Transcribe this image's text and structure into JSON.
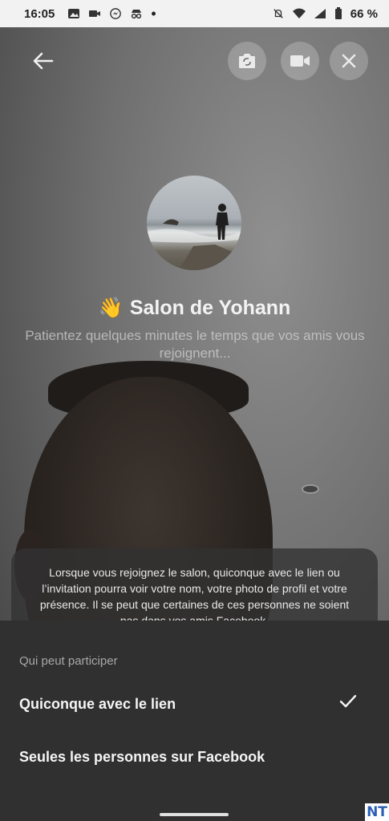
{
  "status_bar": {
    "time": "16:05",
    "battery": "66 %",
    "left_icons": [
      "image-icon",
      "video-camera-icon",
      "messenger-icon",
      "incognito-icon",
      "dot-icon"
    ],
    "right_icons": [
      "mute-icon",
      "wifi-icon",
      "signal-icon",
      "battery-icon"
    ]
  },
  "top_bar": {
    "back_icon": "arrow-left-icon",
    "flip_icon": "camera-flip-icon",
    "video_icon": "video-camera-icon",
    "close_icon": "close-icon"
  },
  "room": {
    "emoji": "👋",
    "title": "Salon de Yohann",
    "subtitle": "Patientez quelques minutes le temps que vos amis vous rejoignent..."
  },
  "info": {
    "text": "Lorsque vous rejoignez le salon, quiconque avec le lien ou l’invitation pourra voir votre nom, votre photo de profil et votre présence. Il se peut que certaines de ces personnes ne soient pas dans vos amis Facebook."
  },
  "sheet": {
    "heading": "Qui peut participer",
    "options": [
      {
        "label": "Quiconque avec le lien",
        "selected": true
      },
      {
        "label": "Seules les personnes sur Facebook",
        "selected": false
      }
    ]
  },
  "watermark": "NT",
  "colors": {
    "sheet_bg": "#303030",
    "status_bar_bg": "#f2f2f2"
  }
}
